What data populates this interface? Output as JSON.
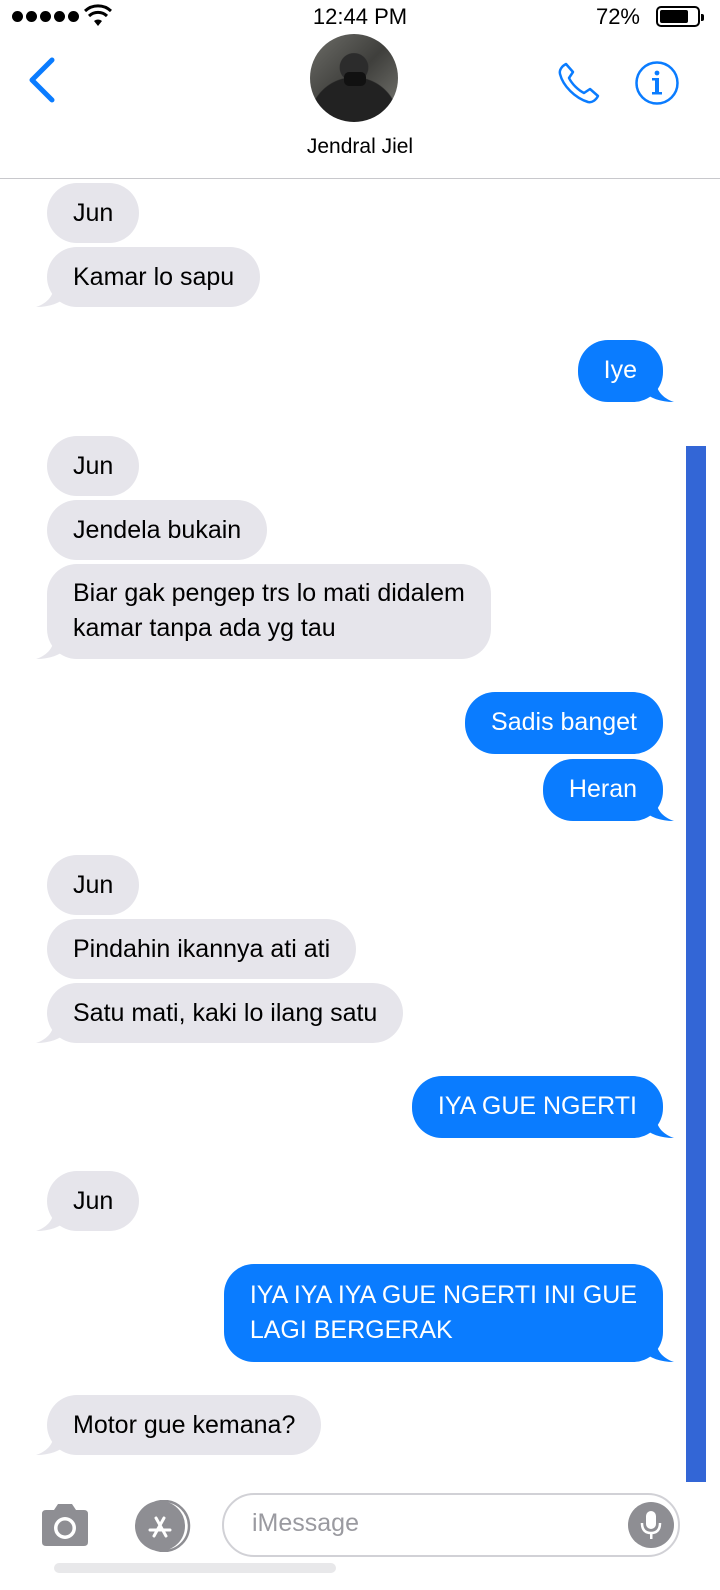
{
  "status_bar": {
    "time": "12:44 PM",
    "battery_percent": "72%",
    "battery_level": 0.72,
    "signal_bars": 5
  },
  "header": {
    "contact_name": "Jendral Jiel",
    "back_icon": "chevron-left-icon",
    "call_icon": "phone-icon",
    "info_icon": "info-icon"
  },
  "messages": [
    {
      "from": "them",
      "text": "Jun"
    },
    {
      "from": "them",
      "text": "Kamar lo sapu"
    },
    {
      "from": "me",
      "text": "Iye"
    },
    {
      "from": "them",
      "text": "Jun"
    },
    {
      "from": "them",
      "text": "Jendela bukain"
    },
    {
      "from": "them",
      "line1": "Biar gak pengep trs lo mati didalem",
      "line2": "kamar tanpa ada yg tau"
    },
    {
      "from": "me",
      "text": "Sadis banget"
    },
    {
      "from": "me",
      "text": "Heran"
    },
    {
      "from": "them",
      "text": "Jun"
    },
    {
      "from": "them",
      "text": "Pindahin ikannya ati ati"
    },
    {
      "from": "them",
      "text": "Satu mati, kaki lo ilang satu"
    },
    {
      "from": "me",
      "text": "IYA GUE NGERTI"
    },
    {
      "from": "them",
      "text": "Jun"
    },
    {
      "from": "me",
      "line1": "IYA IYA IYA GUE NGERTI INI GUE",
      "line2": "LAGI BERGERAK"
    },
    {
      "from": "them",
      "text": "Motor gue kemana?"
    }
  ],
  "composer": {
    "placeholder": "iMessage",
    "camera_icon": "camera-icon",
    "apps_icon": "app-store-icon",
    "mic_icon": "microphone-icon"
  },
  "colors": {
    "accent": "#0a7cff",
    "incoming_bubble": "#e6e5eb",
    "scroll_indicator": "#3366d6"
  }
}
